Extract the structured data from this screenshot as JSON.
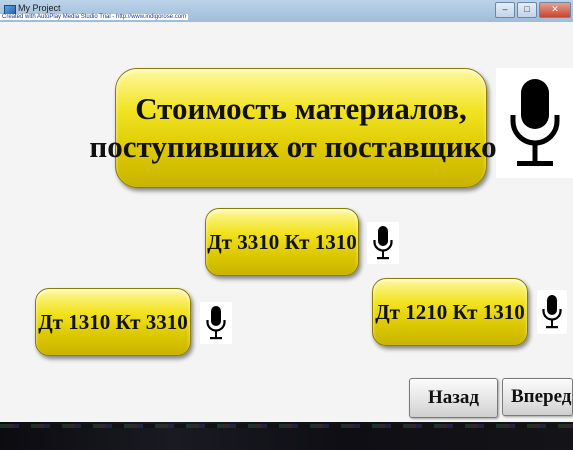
{
  "window": {
    "title": "My Project",
    "credit": "Created with AutoPlay Media Studio Trial - http://www.indigorose.com"
  },
  "controls": {
    "minimize": "–",
    "maximize": "□",
    "close": "✕"
  },
  "main": {
    "title_line1": "Стоимость материалов,",
    "title_line2": "поступивших от поставщиков",
    "buttons": {
      "entry1": "Дт 3310  Кт 1310",
      "entry2": "Дт 1310 Кт 3310",
      "entry3": "Дт 1210  Кт 1310"
    }
  },
  "icons": {
    "large": "microphone-icon",
    "small": "microphone-icon"
  },
  "nav": {
    "back": "Назад",
    "next": "Вперед"
  }
}
